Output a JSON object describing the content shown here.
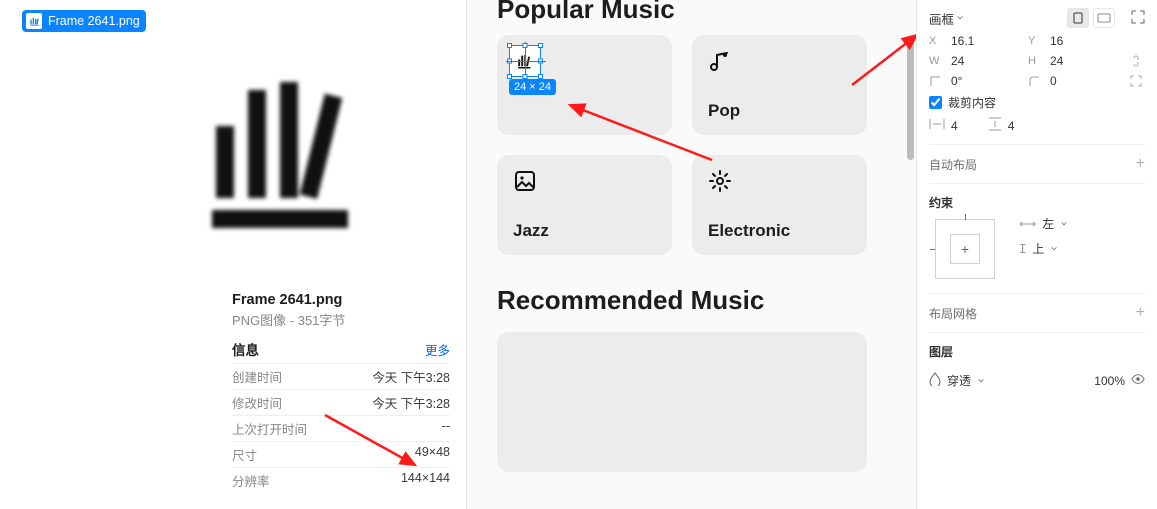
{
  "finder": {
    "file_chip": "Frame 2641.png",
    "filename": "Frame 2641.png",
    "filetype": "PNG图像 - 351字节",
    "info_header": "信息",
    "more_label": "更多",
    "rows": [
      {
        "k": "创建时间",
        "v": "今天 下午3:28"
      },
      {
        "k": "修改时间",
        "v": "今天 下午3:28"
      },
      {
        "k": "上次打开时间",
        "v": "--"
      },
      {
        "k": "尺寸",
        "v": "49×48"
      },
      {
        "k": "分辨率",
        "v": "144×144"
      }
    ]
  },
  "canvas": {
    "heading_popular": "Popular Music",
    "heading_recommended": "Recommended Music",
    "selection_size": "24 × 24",
    "cards": {
      "pop": "Pop",
      "jazz": "Jazz",
      "electronic": "Electronic"
    }
  },
  "inspector": {
    "frame_type": "画框",
    "x_label": "X",
    "x_val": "16.1",
    "y_label": "Y",
    "y_val": "16",
    "w_label": "W",
    "w_val": "24",
    "h_label": "H",
    "h_val": "24",
    "rot_val": "0°",
    "corner_val": "0",
    "clip_label": "裁剪内容",
    "pad_h": "4",
    "pad_v": "4",
    "auto_layout": "自动布局",
    "constraints_title": "约束",
    "constraint_h": "左",
    "constraint_v": "上",
    "layout_grid": "布局网格",
    "layer_title": "图层",
    "blend_mode": "穿透",
    "opacity": "100%"
  }
}
